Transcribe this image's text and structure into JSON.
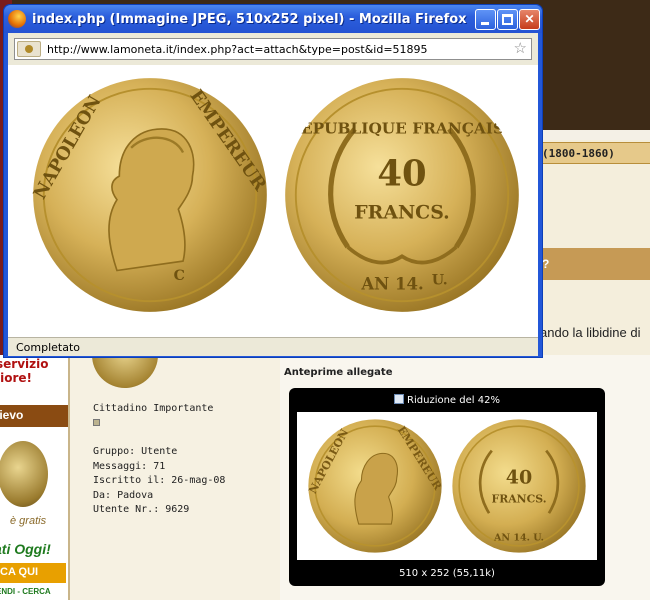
{
  "window": {
    "title": "index.php (Immagine JPEG, 510x252 pixel) - Mozilla Firefox",
    "url": "http://www.lamoneta.it/index.php?act=attach&type=post&id=51895",
    "status": "Completato",
    "buttons": {
      "minimize": "minimize",
      "maximize": "maximize",
      "close": "✕"
    }
  },
  "coin_obverse": {
    "legend": "NAPOLEON EMPEREUR",
    "mark": "C"
  },
  "coin_reverse": {
    "legend": "REPUBLIQUE FRANÇAISE",
    "value": "40",
    "unit": "FRANCS.",
    "date": "AN 14.",
    "mint": "U."
  },
  "background": {
    "title_fragment": "(1800-1860)",
    "question_fragment": "?",
    "body_fragment": "ando la libidine di",
    "ad": {
      "line1": "servizio",
      "line2": "liore!",
      "banner": "lievo",
      "gratis": "è gratis",
      "oggi": "ati Oggi!",
      "qui": "CA QUI",
      "footer": "ENDI - CERCA"
    }
  },
  "user": {
    "rank": "Cittadino Importante",
    "group": "Gruppo: Utente",
    "messages": "Messaggi: 71",
    "registered": "Iscritto il: 26-mag-08",
    "from": "Da: Padova",
    "user_number": "Utente Nr.: 9629"
  },
  "attachments": {
    "heading": "Anteprime allegate",
    "reduction_label": "Riduzione del 42%",
    "size_label": "510 x 252 (55,11k)"
  }
}
